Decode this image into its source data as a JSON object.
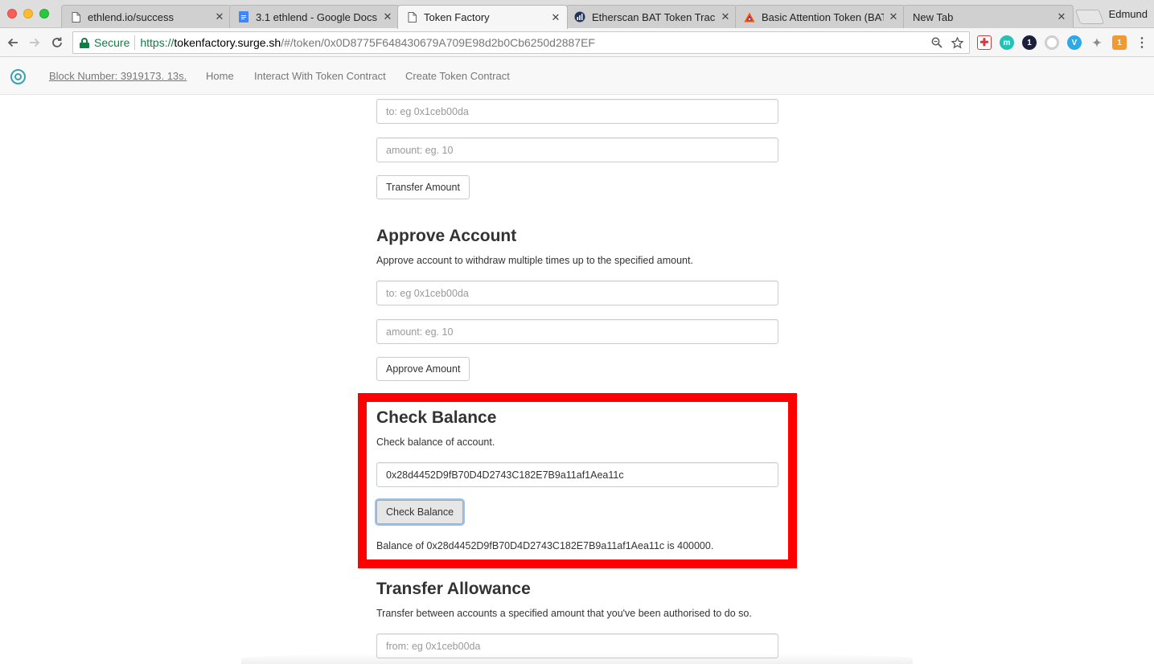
{
  "browser": {
    "tabs": [
      {
        "title": "ethlend.io/success",
        "icon": "page-icon"
      },
      {
        "title": "3.1 ethlend - Google Docs",
        "icon": "google-docs-icon"
      },
      {
        "title": "Token Factory",
        "icon": "page-icon",
        "active": true
      },
      {
        "title": "Etherscan BAT Token Track",
        "icon": "etherscan-icon"
      },
      {
        "title": "Basic Attention Token (BAT",
        "icon": "bat-triangle-icon"
      },
      {
        "title": "New Tab",
        "icon": ""
      }
    ],
    "tab_close_glyph": "✕",
    "profile_name": "Edmund",
    "address_bar": {
      "secure_label": "Secure",
      "scheme": "https://",
      "host": "tokenfactory.surge.sh",
      "path": "/#/token/0x0D8775F648430679A709E98d2b0Cb6250d2887EF"
    },
    "extensions": [
      {
        "name": "red-cross-extension-icon",
        "glyph": "✚",
        "color": "#d63c3c"
      },
      {
        "name": "teal-m-extension-icon",
        "glyph": "m",
        "color": "#20c3b5"
      },
      {
        "name": "one-extension-icon",
        "glyph": "1",
        "color": "#1b1f3b"
      },
      {
        "name": "grey-ring-extension-icon",
        "glyph": "○",
        "color": "#cfcfcf"
      },
      {
        "name": "blue-v-extension-icon",
        "glyph": "V",
        "color": "#2fa8e6"
      },
      {
        "name": "puzzle-extension-icon",
        "glyph": "✦",
        "color": "#8a8a8a"
      },
      {
        "name": "metamask-extension-icon",
        "glyph": "1",
        "color": "#f09a35"
      }
    ]
  },
  "navbar": {
    "block_number": "Block Number: 3919173. 13s.",
    "links": [
      "Home",
      "Interact With Token Contract",
      "Create Token Contract"
    ]
  },
  "transfer": {
    "to_placeholder": "to: eg 0x1ceb00da",
    "amount_placeholder": "amount: eg. 10",
    "button_label": "Transfer Amount"
  },
  "approve": {
    "title": "Approve Account",
    "description": "Approve account to withdraw multiple times up to the specified amount.",
    "to_placeholder": "to: eg 0x1ceb00da",
    "amount_placeholder": "amount: eg. 10",
    "button_label": "Approve Amount"
  },
  "check_balance": {
    "title": "Check Balance",
    "description": "Check balance of account.",
    "address_value": "0x28d4452D9fB70D4D2743C182E7B9a11af1Aea11c",
    "button_label": "Check Balance",
    "result": "Balance of 0x28d4452D9fB70D4D2743C182E7B9a11af1Aea11c is 400000."
  },
  "transfer_allowance": {
    "title": "Transfer Allowance",
    "description": "Transfer between accounts a specified amount that you've been authorised to do so.",
    "from_placeholder": "from: eg 0x1ceb00da"
  },
  "colors": {
    "highlight": "#ff0000",
    "secure_green": "#0b8043",
    "brand_teal": "#3a9fb3"
  }
}
